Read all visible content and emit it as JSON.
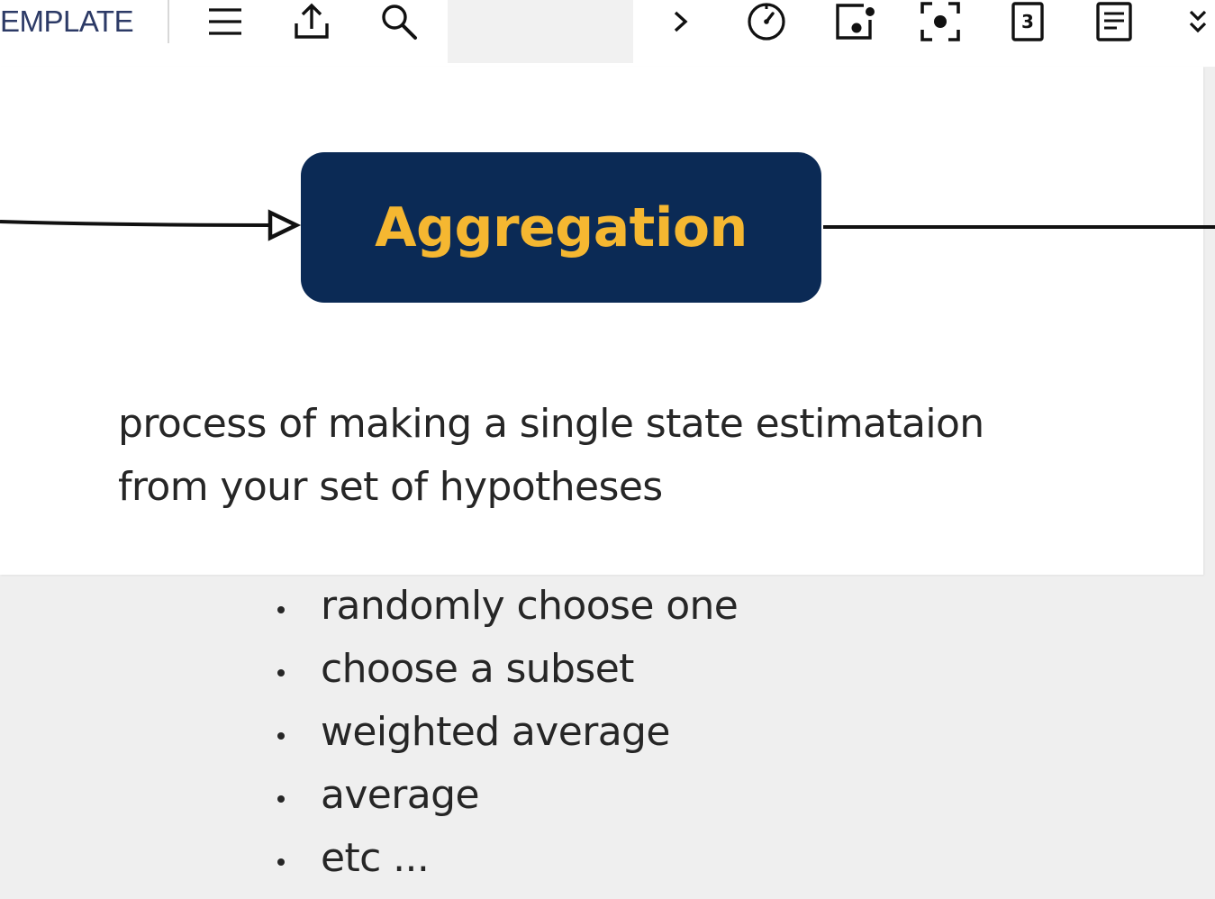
{
  "toolbar": {
    "title": "EMPLATE",
    "buttons": [
      {
        "name": "menu-icon"
      },
      {
        "name": "share-icon"
      },
      {
        "name": "search-icon"
      },
      {
        "name": "chevron-right-icon"
      },
      {
        "name": "stopwatch-icon"
      },
      {
        "name": "record-icon"
      },
      {
        "name": "focus-icon"
      },
      {
        "name": "page-number-icon",
        "label": "3"
      },
      {
        "name": "notes-icon"
      },
      {
        "name": "chevron-down-icon"
      }
    ]
  },
  "slide": {
    "node_label": "Aggregation",
    "description_line1": "process of making a single state estimataion",
    "description_line2": "from your set of hypotheses",
    "bullets": [
      "randomly choose one",
      "choose a subset",
      "weighted average",
      "average",
      "etc ..."
    ]
  },
  "colors": {
    "node_fill": "#0b2a55",
    "node_text": "#f5b731",
    "toolbar_title": "#2c3a66",
    "body_text": "#262626"
  }
}
